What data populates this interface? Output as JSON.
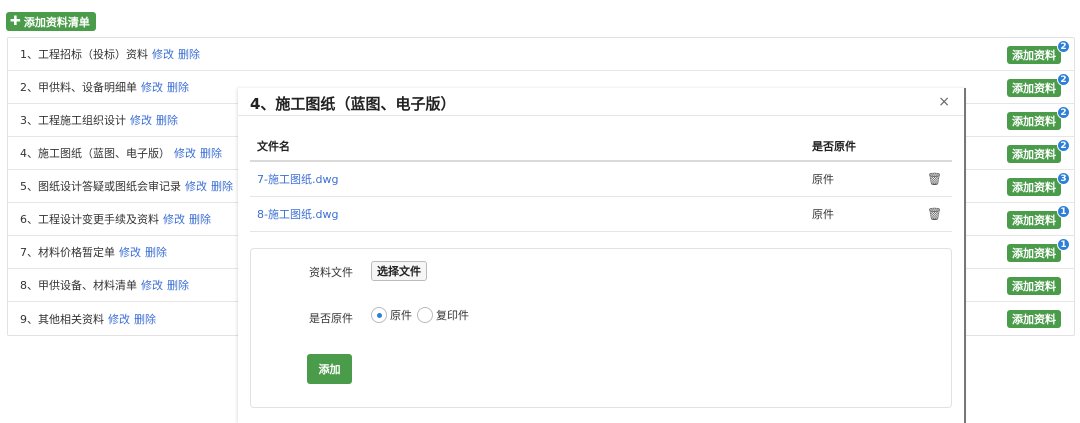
{
  "toolbar": {
    "add_list_label": "添加资料清单"
  },
  "list": {
    "edit_label": "修改",
    "delete_label": "删除",
    "add_button_label": "添加资料",
    "items": [
      {
        "label": "1、工程招标（投标）资料",
        "badge": "2"
      },
      {
        "label": "2、甲供料、设备明细单",
        "badge": "2"
      },
      {
        "label": "3、工程施工组织设计",
        "badge": "2"
      },
      {
        "label": "4、施工图纸（蓝图、电子版）",
        "badge": "2"
      },
      {
        "label": "5、图纸设计答疑或图纸会审记录",
        "badge": "3"
      },
      {
        "label": "6、工程设计变更手续及资料",
        "badge": "1"
      },
      {
        "label": "7、材料价格暂定单",
        "badge": "1"
      },
      {
        "label": "8、甲供设备、材料清单",
        "badge": ""
      },
      {
        "label": "9、其他相关资料",
        "badge": ""
      }
    ]
  },
  "modal": {
    "title": "4、施工图纸（蓝图、电子版）",
    "close_glyph": "×",
    "table": {
      "col_filename": "文件名",
      "col_original": "是否原件",
      "rows": [
        {
          "filename": "7-施工图纸.dwg",
          "original": "原件"
        },
        {
          "filename": "8-施工图纸.dwg",
          "original": "原件"
        }
      ]
    },
    "form": {
      "file_label": "资料文件",
      "choose_file_label": "选择文件",
      "original_label": "是否原件",
      "options": [
        {
          "label": "原件",
          "selected": true
        },
        {
          "label": "复印件",
          "selected": false
        }
      ],
      "submit_label": "添加"
    }
  },
  "colors": {
    "primary_green": "#4a9b4a",
    "link_blue": "#3b6fd4",
    "badge_blue": "#2e7fd8"
  }
}
